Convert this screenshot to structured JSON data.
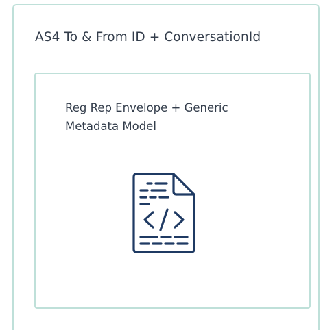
{
  "outer": {
    "label": "AS4 To & From ID + ConversationId"
  },
  "inner": {
    "label": "Reg Rep Envelope + Generic Metadata Model",
    "icon": "code-document-icon"
  },
  "colors": {
    "border": "#bfe0d9",
    "icon_stroke": "#1f3a63",
    "text": "#333d4b"
  }
}
